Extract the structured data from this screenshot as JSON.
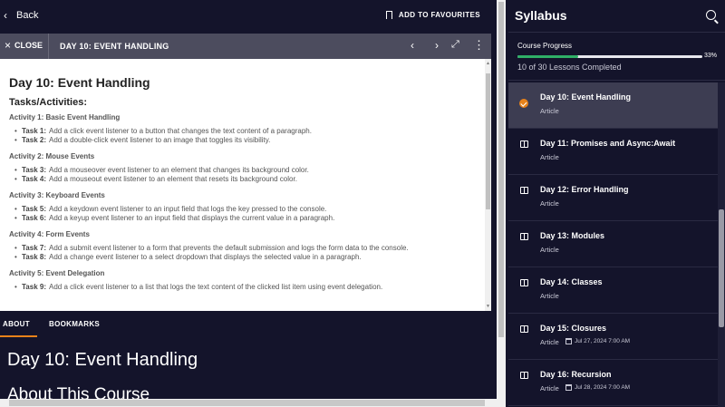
{
  "topbar": {
    "back_label": "Back",
    "favourites_label": "ADD TO FAVOURITES"
  },
  "lessonbar": {
    "close_label": "CLOSE",
    "title": "DAY 10: EVENT HANDLING"
  },
  "content": {
    "heading": "Day 10: Event Handling",
    "subheading": "Tasks/Activities:",
    "activities": [
      {
        "title": "Activity 1: Basic Event Handling",
        "tasks": [
          {
            "label": "Task 1:",
            "text": "Add a click event listener to a button that changes the text content of a paragraph."
          },
          {
            "label": "Task 2:",
            "text": "Add a double-click event listener to an image that toggles its visibility."
          }
        ]
      },
      {
        "title": "Activity 2: Mouse Events",
        "tasks": [
          {
            "label": "Task 3:",
            "text": "Add a mouseover event listener to an element that changes its background color."
          },
          {
            "label": "Task 4:",
            "text": "Add a mouseout event listener to an element that resets its background color."
          }
        ]
      },
      {
        "title": "Activity 3: Keyboard Events",
        "tasks": [
          {
            "label": "Task 5:",
            "text": "Add a keydown event listener to an input field that logs the key pressed to the console."
          },
          {
            "label": "Task 6:",
            "text": "Add a keyup event listener to an input field that displays the current value in a paragraph."
          }
        ]
      },
      {
        "title": "Activity 4: Form Events",
        "tasks": [
          {
            "label": "Task 7:",
            "text": "Add a submit event listener to a form that prevents the default submission and logs the form data to the console."
          },
          {
            "label": "Task 8:",
            "text": "Add a change event listener to a select dropdown that displays the selected value in a paragraph."
          }
        ]
      },
      {
        "title": "Activity 5: Event Delegation",
        "tasks": [
          {
            "label": "Task 9:",
            "text": "Add a click event listener to a list that logs the text content of the clicked list item using event delegation."
          }
        ]
      }
    ]
  },
  "tabs": {
    "about": "ABOUT",
    "bookmarks": "BOOKMARKS"
  },
  "about": {
    "title": "Day 10: Event Handling",
    "course_heading": "About This Course"
  },
  "sidebar": {
    "title": "Syllabus",
    "progress_label": "Course Progress",
    "progress_percent_text": "33%",
    "progress_fraction": 0.33,
    "progress_count": "10 of 30 Lessons Completed",
    "lessons": [
      {
        "title": "Day 10: Event Handling",
        "type": "Article",
        "date": "",
        "active": true,
        "icon": "check-icon"
      },
      {
        "title": "Day 11: Promises and Async:Await",
        "type": "Article",
        "date": "",
        "icon": "book-icon"
      },
      {
        "title": "Day 12: Error Handling",
        "type": "Article",
        "date": "",
        "icon": "book-icon"
      },
      {
        "title": "Day 13: Modules",
        "type": "Article",
        "date": "",
        "icon": "book-icon"
      },
      {
        "title": "Day 14: Classes",
        "type": "Article",
        "date": "",
        "icon": "book-icon"
      },
      {
        "title": "Day 15: Closures",
        "type": "Article",
        "date": "Jul 27, 2024 7:00 AM",
        "icon": "book-icon"
      },
      {
        "title": "Day 16: Recursion",
        "type": "Article",
        "date": "Jul 28, 2024 7:00 AM",
        "icon": "book-icon"
      }
    ]
  },
  "colors": {
    "background": "#14142b",
    "accent": "#e8821a",
    "progress": "#2fb067",
    "active_row": "#3d3d52"
  }
}
